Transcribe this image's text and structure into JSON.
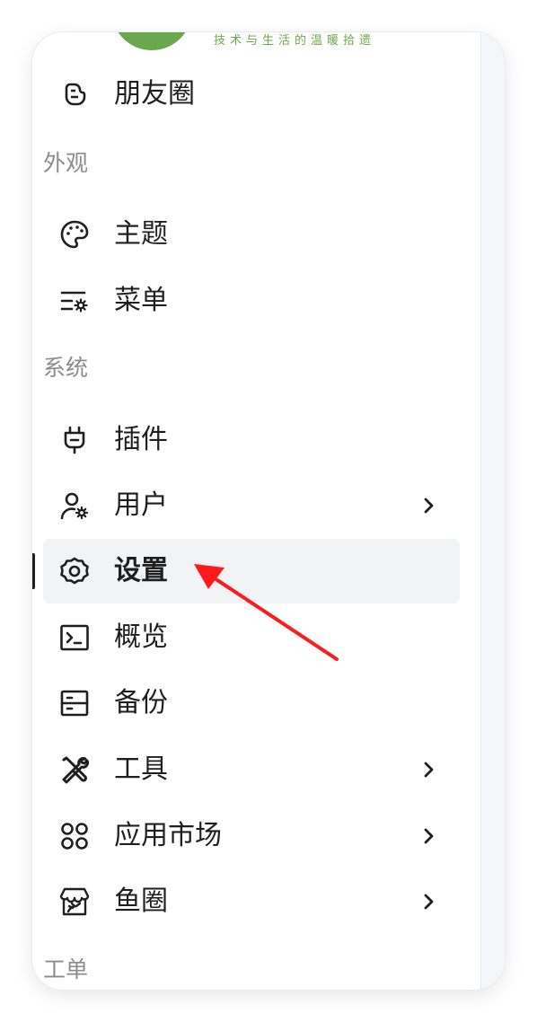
{
  "brand": {
    "slogan": "技术与生活的温暖拾遗",
    "color": "#6aa94b"
  },
  "items": {
    "moments": "朋友圈",
    "theme": "主题",
    "menu": "菜单",
    "plugins": "插件",
    "users": "用户",
    "settings": "设置",
    "overview": "概览",
    "backup": "备份",
    "tools": "工具",
    "app_market": "应用市场",
    "fish_circle": "鱼圈"
  },
  "groups": {
    "appearance": "外观",
    "system": "系统",
    "tickets": "工单"
  },
  "active_item": "settings",
  "colors": {
    "active_bg": "#f2f3f5",
    "annotation_arrow": "#ff1a1a"
  }
}
